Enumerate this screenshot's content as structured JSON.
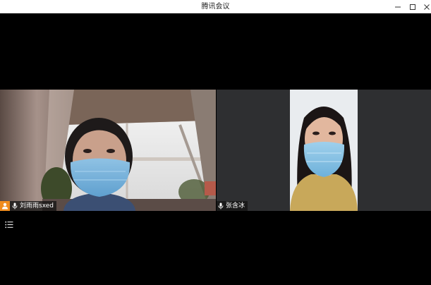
{
  "window": {
    "title": "腾讯会议"
  },
  "participants": [
    {
      "name": "刘雨雨sxed",
      "is_host": true,
      "mic": "on"
    },
    {
      "name": "张含冰",
      "is_host": false,
      "mic": "on"
    }
  ],
  "colors": {
    "host_badge": "#f08c1e",
    "stage_background": "#000000",
    "tile_background": "#2e2f31"
  },
  "icons": {
    "minimize": "minimize-icon",
    "maximize": "maximize-icon",
    "close": "close-icon",
    "host": "host-user-icon",
    "mic": "microphone-icon",
    "list": "list-menu-icon"
  }
}
